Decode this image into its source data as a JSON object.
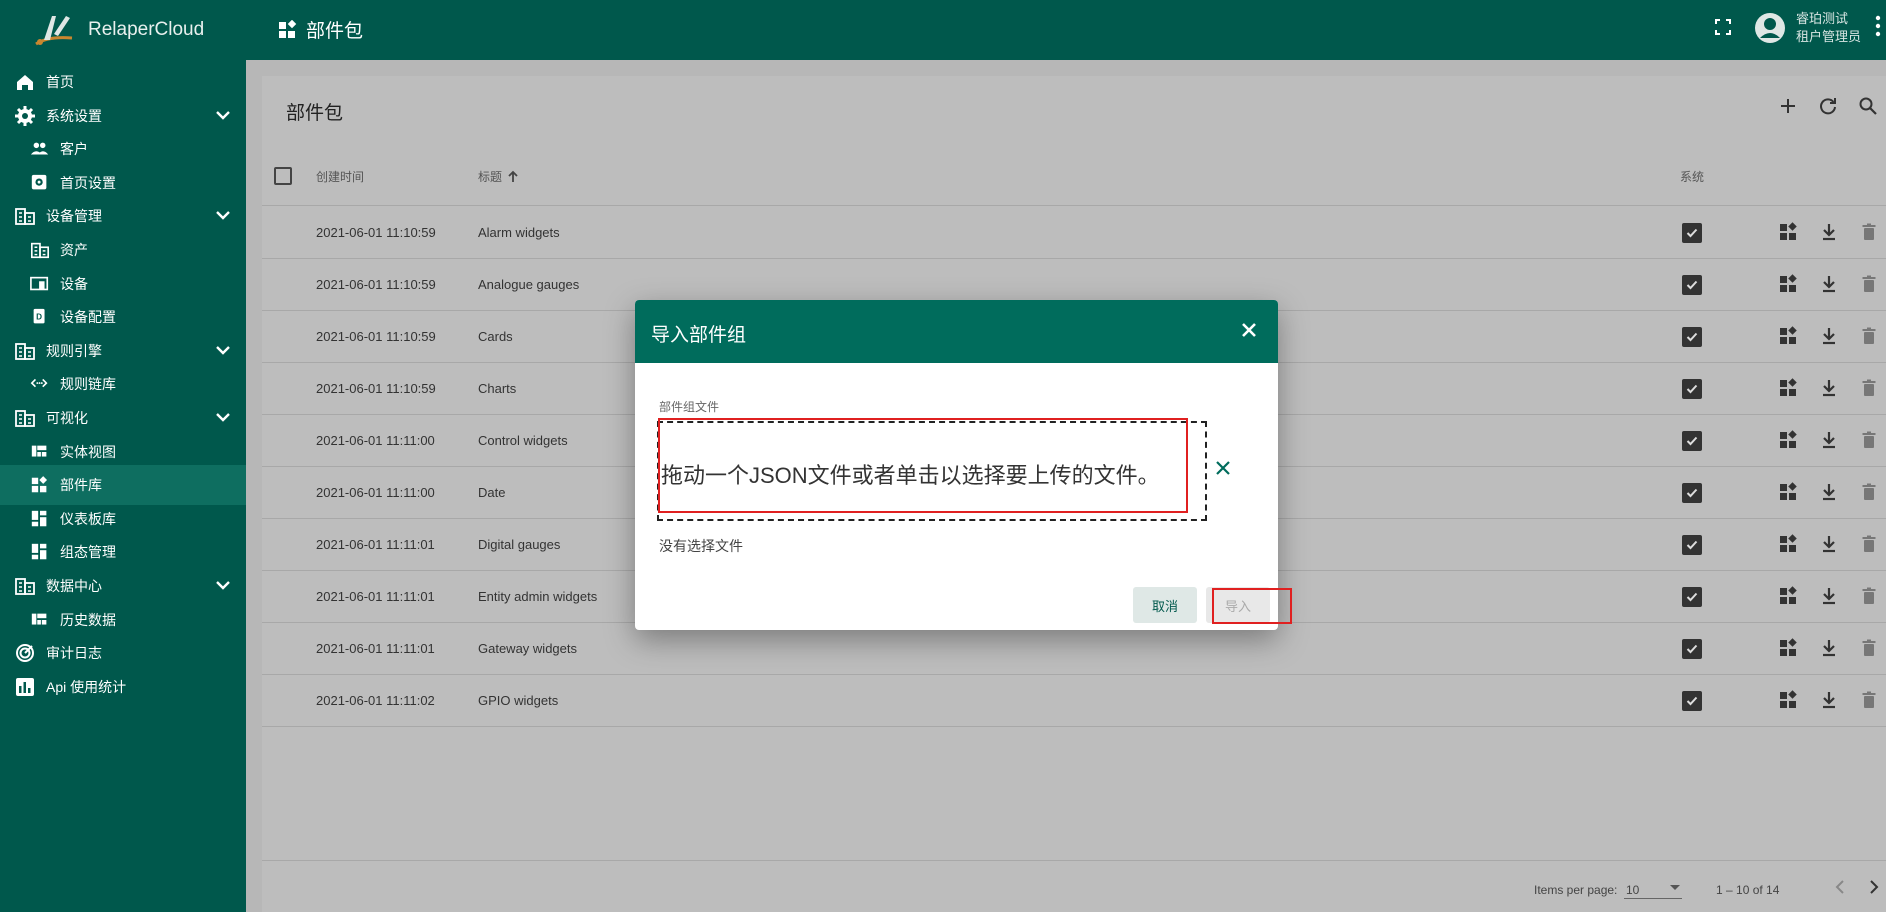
{
  "app": {
    "name": "RelaperCloud"
  },
  "header": {
    "title": "部件包",
    "user_name": "睿珀测试",
    "user_role": "租户管理员"
  },
  "sidebar": {
    "items": [
      {
        "label": "首页",
        "icon": "home-icon",
        "level": "top"
      },
      {
        "label": "系统设置",
        "icon": "gear-icon",
        "level": "top",
        "expandable": true
      },
      {
        "label": "客户",
        "icon": "people-icon",
        "level": "sub"
      },
      {
        "label": "首页设置",
        "icon": "settings-box-icon",
        "level": "sub"
      },
      {
        "label": "设备管理",
        "icon": "domain-icon",
        "level": "top",
        "expandable": true
      },
      {
        "label": "资产",
        "icon": "domain-icon",
        "level": "sub"
      },
      {
        "label": "设备",
        "icon": "devices-icon",
        "level": "sub"
      },
      {
        "label": "设备配置",
        "icon": "device-profile-icon",
        "level": "sub"
      },
      {
        "label": "规则引擎",
        "icon": "domain-icon",
        "level": "top",
        "expandable": true
      },
      {
        "label": "规则链库",
        "icon": "code-icon",
        "level": "sub"
      },
      {
        "label": "可视化",
        "icon": "domain-icon",
        "level": "top",
        "expandable": true
      },
      {
        "label": "实体视图",
        "icon": "view-quilt-icon",
        "level": "sub"
      },
      {
        "label": "部件库",
        "icon": "widgets-icon",
        "level": "sub",
        "active": true
      },
      {
        "label": "仪表板库",
        "icon": "dashboard-icon",
        "level": "sub"
      },
      {
        "label": "组态管理",
        "icon": "dashboard-icon",
        "level": "sub"
      },
      {
        "label": "数据中心",
        "icon": "domain-icon",
        "level": "top",
        "expandable": true
      },
      {
        "label": "历史数据",
        "icon": "view-quilt-icon",
        "level": "sub"
      },
      {
        "label": "审计日志",
        "icon": "track-changes-icon",
        "level": "top"
      },
      {
        "label": "Api 使用统计",
        "icon": "insert-chart-icon",
        "level": "top"
      }
    ]
  },
  "card": {
    "title": "部件包",
    "columns": {
      "created": "创建时间",
      "title": "标题",
      "system": "系统"
    },
    "rows": [
      {
        "created": "2021-06-01 11:10:59",
        "title": "Alarm widgets",
        "system": true
      },
      {
        "created": "2021-06-01 11:10:59",
        "title": "Analogue gauges",
        "system": true
      },
      {
        "created": "2021-06-01 11:10:59",
        "title": "Cards",
        "system": true
      },
      {
        "created": "2021-06-01 11:10:59",
        "title": "Charts",
        "system": true
      },
      {
        "created": "2021-06-01 11:11:00",
        "title": "Control widgets",
        "system": true
      },
      {
        "created": "2021-06-01 11:11:00",
        "title": "Date",
        "system": true
      },
      {
        "created": "2021-06-01 11:11:01",
        "title": "Digital gauges",
        "system": true
      },
      {
        "created": "2021-06-01 11:11:01",
        "title": "Entity admin widgets",
        "system": true
      },
      {
        "created": "2021-06-01 11:11:01",
        "title": "Gateway widgets",
        "system": true
      },
      {
        "created": "2021-06-01 11:11:02",
        "title": "GPIO widgets",
        "system": true
      }
    ],
    "paginator": {
      "label": "Items per page:",
      "page_size": "10",
      "range": "1 – 10 of 14"
    }
  },
  "dialog": {
    "title": "导入部件组",
    "field_label": "部件组文件",
    "drop_text": "拖动一个JSON文件或者单击以选择要上传的文件。",
    "no_file": "没有选择文件",
    "cancel_label": "取消",
    "import_label": "导入"
  },
  "colors": {
    "primary": "#00584c",
    "dialog_header": "#006c5c",
    "highlight": "#e02020"
  }
}
